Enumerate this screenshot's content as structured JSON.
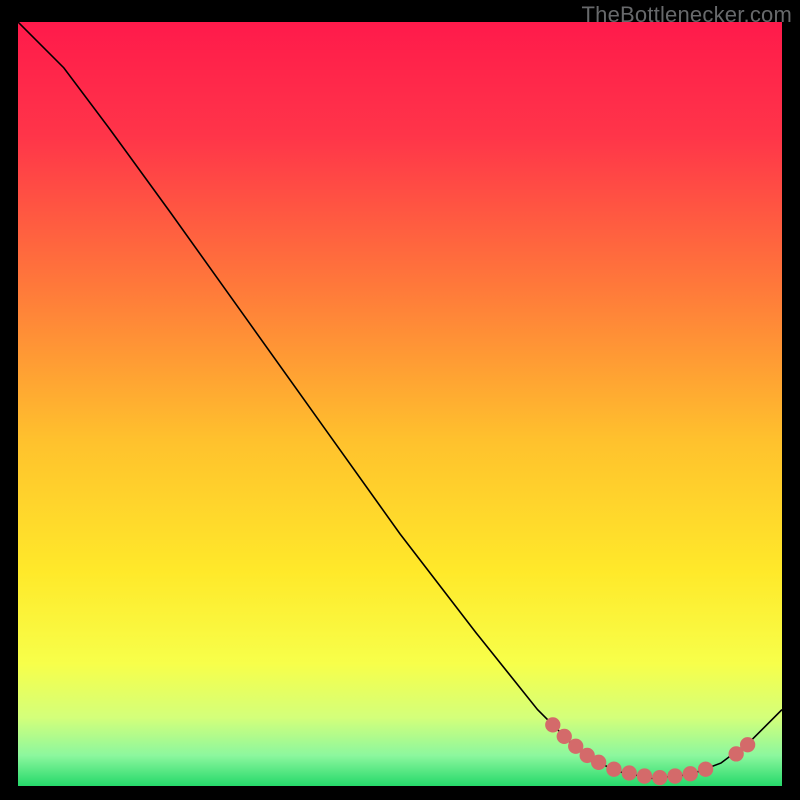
{
  "watermark": "TheBottlenecker.com",
  "chart_data": {
    "type": "line",
    "title": "",
    "xlabel": "",
    "ylabel": "",
    "xlim": [
      0,
      100
    ],
    "ylim": [
      0,
      100
    ],
    "grid": false,
    "curve": [
      {
        "x": 0,
        "y": 100
      },
      {
        "x": 6,
        "y": 94
      },
      {
        "x": 12,
        "y": 86
      },
      {
        "x": 20,
        "y": 75
      },
      {
        "x": 30,
        "y": 61
      },
      {
        "x": 40,
        "y": 47
      },
      {
        "x": 50,
        "y": 33
      },
      {
        "x": 60,
        "y": 20
      },
      {
        "x": 68,
        "y": 10
      },
      {
        "x": 73,
        "y": 5
      },
      {
        "x": 78,
        "y": 2
      },
      {
        "x": 83,
        "y": 1
      },
      {
        "x": 88,
        "y": 1.5
      },
      {
        "x": 92,
        "y": 3
      },
      {
        "x": 96,
        "y": 6
      },
      {
        "x": 100,
        "y": 10
      }
    ],
    "dots": [
      {
        "x": 70,
        "y": 8.0
      },
      {
        "x": 71.5,
        "y": 6.5
      },
      {
        "x": 73,
        "y": 5.2
      },
      {
        "x": 74.5,
        "y": 4.0
      },
      {
        "x": 76,
        "y": 3.1
      },
      {
        "x": 78,
        "y": 2.2
      },
      {
        "x": 80,
        "y": 1.7
      },
      {
        "x": 82,
        "y": 1.3
      },
      {
        "x": 84,
        "y": 1.1
      },
      {
        "x": 86,
        "y": 1.3
      },
      {
        "x": 88,
        "y": 1.6
      },
      {
        "x": 90,
        "y": 2.2
      },
      {
        "x": 94,
        "y": 4.2
      },
      {
        "x": 95.5,
        "y": 5.4
      }
    ],
    "gradient_stops": [
      {
        "offset": 0.0,
        "color": "#ff1a4b"
      },
      {
        "offset": 0.15,
        "color": "#ff3549"
      },
      {
        "offset": 0.35,
        "color": "#ff7a3a"
      },
      {
        "offset": 0.55,
        "color": "#ffc22d"
      },
      {
        "offset": 0.72,
        "color": "#ffe92a"
      },
      {
        "offset": 0.84,
        "color": "#f7ff4a"
      },
      {
        "offset": 0.91,
        "color": "#d4ff7a"
      },
      {
        "offset": 0.96,
        "color": "#8cf79e"
      },
      {
        "offset": 1.0,
        "color": "#25d96a"
      }
    ],
    "dot_color": "#d46a6a",
    "line_color": "#000000"
  }
}
